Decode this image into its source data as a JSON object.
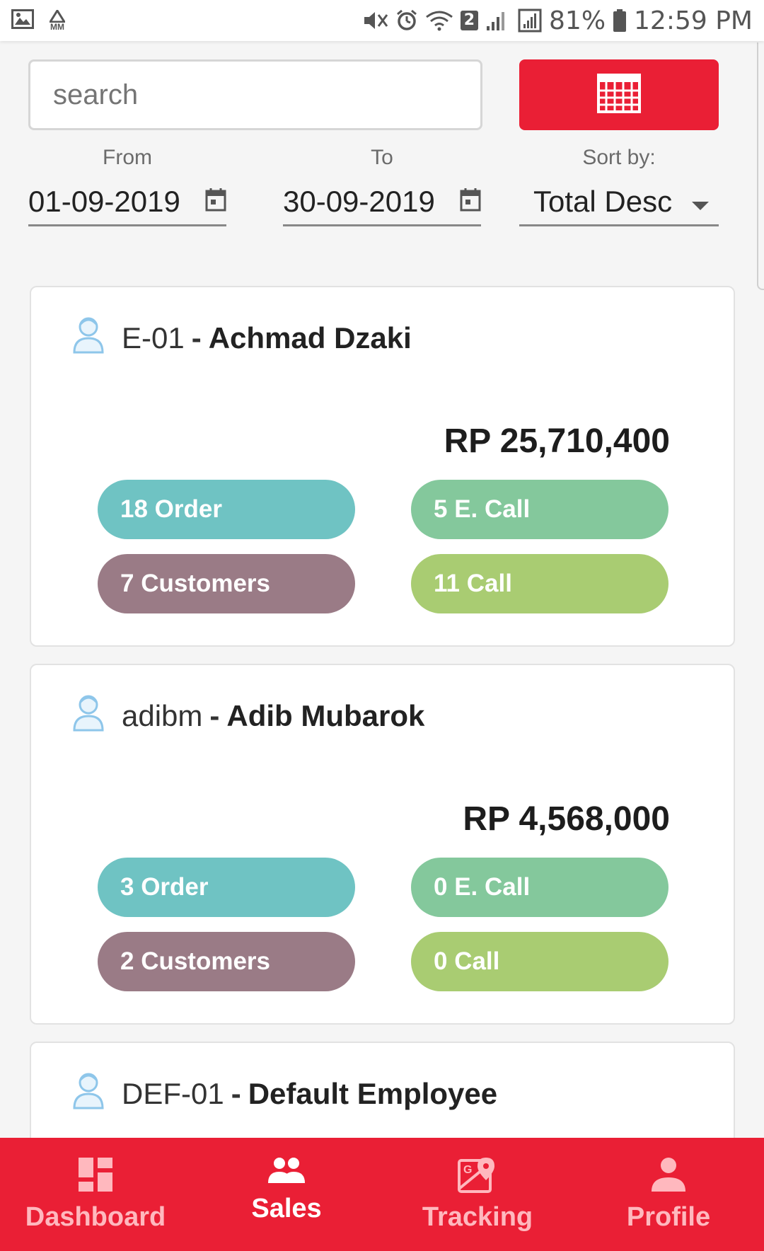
{
  "status_bar": {
    "carrier_badge": "MM",
    "sim_number": "2",
    "battery": "81%",
    "time": "12:59 PM"
  },
  "search": {
    "placeholder": "search",
    "value": ""
  },
  "filters": {
    "from_label": "From",
    "from_value": "01-09-2019",
    "to_label": "To",
    "to_value": "30-09-2019",
    "sort_label": "Sort by:",
    "sort_value": "Total Desc"
  },
  "employees": [
    {
      "code": "E-01",
      "separator": "-",
      "name": "Achmad Dzaki",
      "total": "RP 25,710,400",
      "orders": "18 Order",
      "effective_calls": "5 E. Call",
      "customers": "7 Customers",
      "calls": "11 Call"
    },
    {
      "code": "adibm",
      "separator": "-",
      "name": "Adib Mubarok",
      "total": "RP 4,568,000",
      "orders": "3 Order",
      "effective_calls": "0 E. Call",
      "customers": "2 Customers",
      "calls": "0 Call"
    },
    {
      "code": "DEF-01",
      "separator": "-",
      "name": "Default Employee"
    }
  ],
  "bottom_nav": {
    "items": [
      {
        "label": "Dashboard",
        "icon": "dashboard-icon",
        "active": false
      },
      {
        "label": "Sales",
        "icon": "people-icon",
        "active": true
      },
      {
        "label": "Tracking",
        "icon": "map-icon",
        "active": false
      },
      {
        "label": "Profile",
        "icon": "person-icon",
        "active": false
      }
    ]
  },
  "colors": {
    "accent": "#ea1f35",
    "pill_order": "#6fc3c3",
    "pill_ecall": "#84c89c",
    "pill_customers": "#9a7b86",
    "pill_call": "#a9cc72"
  }
}
